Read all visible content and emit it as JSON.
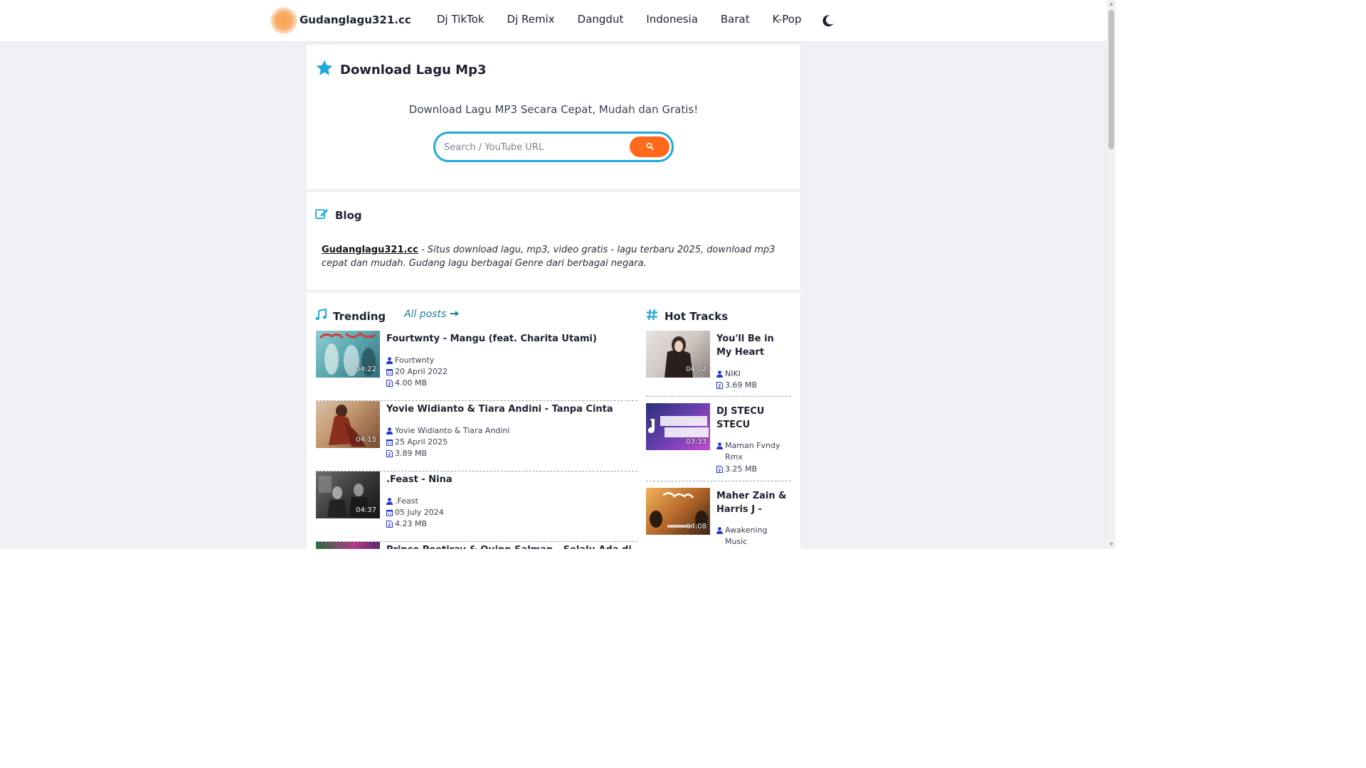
{
  "header": {
    "site_name": "Gudanglagu321.cc",
    "nav": [
      "Dj TikTok",
      "Dj Remix",
      "Dangdut",
      "Indonesia",
      "Barat",
      "K-Pop"
    ],
    "theme_icon": "moon-icon"
  },
  "hero": {
    "title": "Download Lagu Mp3",
    "subtitle": "Download Lagu MP3 Secara Cepat, Mudah dan Gratis!",
    "search_placeholder": "Search / YouTube URL",
    "search_icon": "search-icon"
  },
  "blog": {
    "title": "Blog",
    "brand": "Gudanglagu321.cc",
    "text": " - Situs download lagu, mp3, video gratis - lagu terbaru 2025, download mp3 cepat dan mudah. Gudang lagu berbagai Genre dari berbagai negara."
  },
  "trending": {
    "title": "Trending",
    "all_posts": "All posts",
    "items": [
      {
        "title": "Fourtwnty - Mangu (feat. Charita Utami)",
        "duration": "04:22",
        "artist": "Fourtwnty",
        "date": "20 April 2022",
        "size": "4.00 MB"
      },
      {
        "title": "Yovie Widianto & Tiara Andini - Tanpa Cinta",
        "duration": "04:15",
        "artist": "Yovie Widianto & Tiara Andini",
        "date": "25 April 2025",
        "size": "3.89 MB"
      },
      {
        "title": ".Feast - Nina",
        "duration": "04:37",
        "artist": ".Feast",
        "date": "05 July 2024",
        "size": "4.23 MB"
      },
      {
        "title": "Prince Poetiray & Quinn Salman - Selalu Ada di"
      }
    ]
  },
  "hot_tracks": {
    "title": "Hot Tracks",
    "items": [
      {
        "title": "You'll Be in My Heart (Spotify...",
        "duration": "04:02",
        "artist": "NIKI",
        "size": "3.69 MB"
      },
      {
        "title": "DJ STECU STECU SETELA...",
        "duration": "03:33",
        "artist": "Maman Fvndy Rmx",
        "size": "3.25 MB"
      },
      {
        "title": "Maher Zain & Harris J - Qal...",
        "duration": "04:08",
        "artist": "Awakening Music"
      }
    ]
  },
  "colors": {
    "accent_blue": "#1ea9de",
    "accent_orange": "#ff6a1a",
    "meta_icon_blue": "#2633d9"
  }
}
